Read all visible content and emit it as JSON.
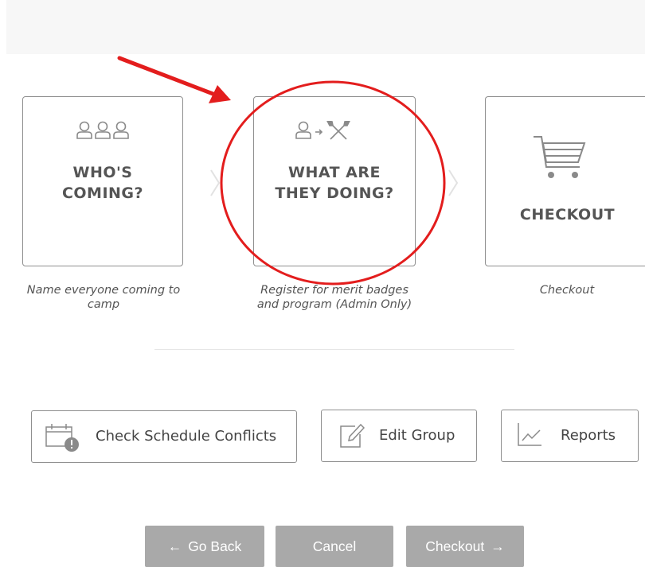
{
  "steps": [
    {
      "title_line1": "WHO'S",
      "title_line2": "COMING?",
      "icon": "people-icon",
      "caption_line1": "Name everyone coming to",
      "caption_line2": "camp"
    },
    {
      "title_line1": "WHAT ARE",
      "title_line2": "THEY DOING?",
      "icon": "person-to-paddles-icon",
      "caption_line1": "Register for merit badges",
      "caption_line2": "and program (Admin Only)"
    },
    {
      "title_line1": "CHECKOUT",
      "title_line2": "",
      "icon": "shopping-cart-icon",
      "caption_line1": "Checkout",
      "caption_line2": ""
    }
  ],
  "tools": {
    "conflicts_label": "Check Schedule Conflicts",
    "edit_group_label": "Edit Group",
    "reports_label": "Reports"
  },
  "nav": {
    "go_back_label": "Go Back",
    "cancel_label": "Cancel",
    "checkout_label": "Checkout"
  },
  "colors": {
    "annotation_red": "#e31d1d",
    "nav_button_gray": "#a9a9a9",
    "icon_gray": "#8a8a8a"
  }
}
